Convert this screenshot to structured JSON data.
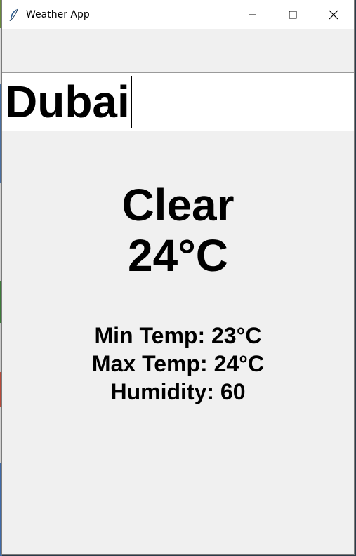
{
  "window": {
    "title": "Weather App",
    "app_icon": "feather-icon",
    "controls": [
      "minimize-icon",
      "maximize-icon",
      "close-icon"
    ]
  },
  "search": {
    "value": "Dubai"
  },
  "weather": {
    "condition": "Clear",
    "temperature": "24°C",
    "min_temp": "Min Temp: 23°C",
    "max_temp": "Max Temp: 24°C",
    "humidity": "Humidity: 60"
  }
}
